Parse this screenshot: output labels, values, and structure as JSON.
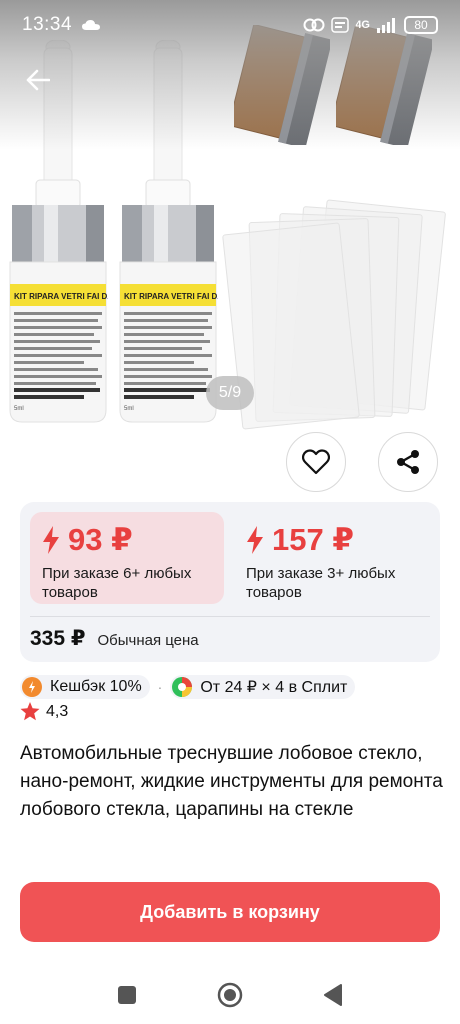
{
  "status_bar": {
    "time": "13:34",
    "network": "4G",
    "battery": "80"
  },
  "gallery": {
    "counter": "5/9",
    "bottle_label": "KIT RIPARA VETRI FAI DA TE",
    "bottle_volume": "5ml"
  },
  "offers": [
    {
      "price": "93 ₽",
      "condition": "При заказе 6+ любых товаров"
    },
    {
      "price": "157 ₽",
      "condition": "При заказе 3+ любых товаров"
    }
  ],
  "regular": {
    "price": "335 ₽",
    "label": "Обычная цена"
  },
  "promos": {
    "cashback": "Кешбэк 10%",
    "split": "От 24 ₽ × 4 в Сплит"
  },
  "rating": "4,3",
  "product_title": "Автомобильные треснувшие лобовое стекло, нано-ремонт, жидкие инструменты для ремонта лобового стекла, царапины на стекле",
  "cart_button": "Добавить в корзину",
  "colors": {
    "accent": "#f05355",
    "price_red": "#e8403f",
    "tier_highlight": "#f6dde1",
    "card_bg": "#f2f3f7"
  }
}
